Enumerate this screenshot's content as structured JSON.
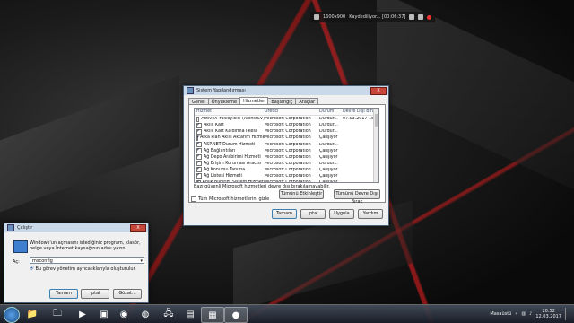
{
  "recorder": {
    "resolution": "1600x900",
    "status": "Kaydediliyor... [00:06:37]"
  },
  "msconfig": {
    "title": "Sistem Yapılandırması",
    "close": "X",
    "tabs": [
      "Genel",
      "Önyükleme",
      "Hizmetler",
      "Başlangıç",
      "Araçlar"
    ],
    "active_tab": "Hizmetler",
    "columns": [
      "Hizmet",
      "Üretici",
      "Durum",
      "Devre Dışı Bırak..."
    ],
    "rows": [
      {
        "name": "ActiveX Yükleyicisi (AxInstSV)",
        "maker": "Microsoft Corporation",
        "status": "Durdur...",
        "date": "07.03.2017 15:...",
        "checked": false
      },
      {
        "name": "Akıllı Kart",
        "maker": "Microsoft Corporation",
        "status": "Durdur...",
        "date": "",
        "checked": true
      },
      {
        "name": "Akıllı Kart Kaldırma İlkesi",
        "maker": "Microsoft Corporation",
        "status": "Durdur...",
        "date": "",
        "checked": true
      },
      {
        "name": "Arka Plan Akıllı Aktarım Hizmeti",
        "maker": "Microsoft Corporation",
        "status": "Çalışıyor",
        "date": "",
        "checked": true
      },
      {
        "name": "ASP.NET Durum Hizmeti",
        "maker": "Microsoft Corporation",
        "status": "Durdur...",
        "date": "",
        "checked": true
      },
      {
        "name": "Ağ Bağlantıları",
        "maker": "Microsoft Corporation",
        "status": "Çalışıyor",
        "date": "",
        "checked": true
      },
      {
        "name": "Ağ Depo Arabirimi Hizmeti",
        "maker": "Microsoft Corporation",
        "status": "Çalışıyor",
        "date": "",
        "checked": true
      },
      {
        "name": "Ağ Erişim Koruması Aracısı",
        "maker": "Microsoft Corporation",
        "status": "Durdur...",
        "date": "",
        "checked": true
      },
      {
        "name": "Ağ Konumu Tanıma",
        "maker": "Microsoft Corporation",
        "status": "Çalışıyor",
        "date": "",
        "checked": true
      },
      {
        "name": "Ağ Listesi Hizmeti",
        "maker": "Microsoft Corporation",
        "status": "Çalışıyor",
        "date": "",
        "checked": true
      },
      {
        "name": "Anlık Bildirim Sistem Hizmeti",
        "maker": "Microsoft Corporation",
        "status": "Çalışıyor",
        "date": "",
        "checked": true
      }
    ],
    "note": "Bazı güvenli Microsoft hizmetleri devre dışı bırakılamayabilir.",
    "enable_all": "Tümünü Etkinleştir",
    "disable_all": "Tümünü Devre Dışı Bırak",
    "hide_ms": "Tüm Microsoft hizmetlerini gizle",
    "ok": "Tamam",
    "cancel": "İptal",
    "apply": "Uygula",
    "help": "Yardım"
  },
  "run": {
    "title": "Çalıştır",
    "close": "X",
    "description": "Windows'un açmasını istediğiniz program, klasör, belge veya İnternet kaynağının adını yazın.",
    "open_label": "Aç:",
    "value": "msconfig",
    "admin_note": "Bu görev yönetim ayrıcalıklarıyla oluşturulur.",
    "ok": "Tamam",
    "cancel": "İptal",
    "browse": "Gözat..."
  },
  "taskbar": {
    "desktop_label": "Masaüstü",
    "time": "20:52",
    "date": "12.03.2017"
  }
}
